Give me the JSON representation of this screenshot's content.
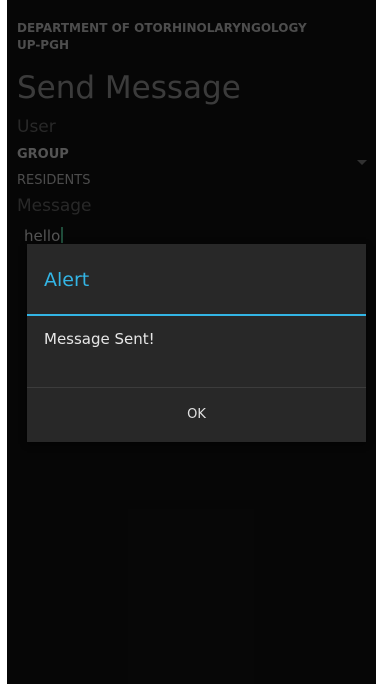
{
  "app_header": {
    "line1": "DEPARTMENT OF OTORHINOLARYNGOLOGY",
    "line2": "UP-PGH"
  },
  "screen": {
    "title": "Send Message",
    "user_label": "User",
    "group_label": "GROUP",
    "group_value": "RESIDENTS",
    "message_label": "Message",
    "message_value": "hello"
  },
  "dialog": {
    "title": "Alert",
    "message": "Message Sent!",
    "ok_label": "OK"
  },
  "colors": {
    "accent": "#33b5e5",
    "background": "#0c0c0c",
    "dialog_background": "#282828"
  },
  "icons": {
    "spinner_arrow": "dropdown-triangle-icon"
  }
}
